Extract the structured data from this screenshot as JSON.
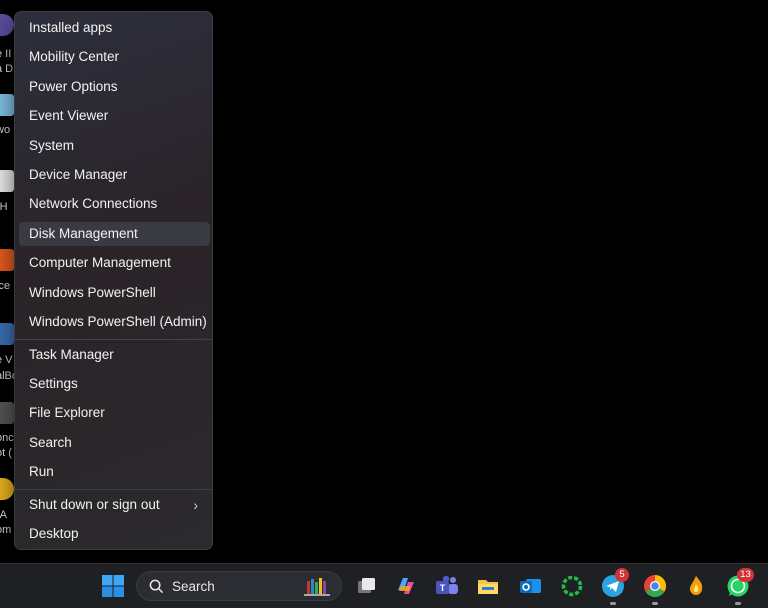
{
  "desktop": {
    "labels": [
      {
        "text": "e II"
      },
      {
        "text": "a D"
      },
      {
        "text": "wo"
      },
      {
        "text": "-H"
      },
      {
        "text": "ice"
      },
      {
        "text": "e V"
      },
      {
        "text": "alBo"
      },
      {
        "text": "onc"
      },
      {
        "text": "ot ("
      },
      {
        "text": "(A"
      },
      {
        "text": "om"
      }
    ]
  },
  "menu": {
    "items": [
      {
        "label": "Installed apps"
      },
      {
        "label": "Mobility Center"
      },
      {
        "label": "Power Options"
      },
      {
        "label": "Event Viewer"
      },
      {
        "label": "System"
      },
      {
        "label": "Device Manager"
      },
      {
        "label": "Network Connections"
      },
      {
        "label": "Disk Management"
      },
      {
        "label": "Computer Management"
      },
      {
        "label": "Windows PowerShell"
      },
      {
        "label": "Windows PowerShell (Admin)"
      },
      {
        "label": "Task Manager"
      },
      {
        "label": "Settings"
      },
      {
        "label": "File Explorer"
      },
      {
        "label": "Search"
      },
      {
        "label": "Run"
      },
      {
        "label": "Shut down or sign out"
      },
      {
        "label": "Desktop"
      }
    ],
    "highlighted": "Disk Management"
  },
  "taskbar": {
    "search_label": "Search",
    "telegram_badge": "5",
    "whatsapp_badge": "13"
  },
  "colors": {
    "menu_bg": "#2b2a30",
    "highlight": "#3a3a42",
    "taskbar_bg": "#1f2024",
    "badge": "#d13438"
  }
}
